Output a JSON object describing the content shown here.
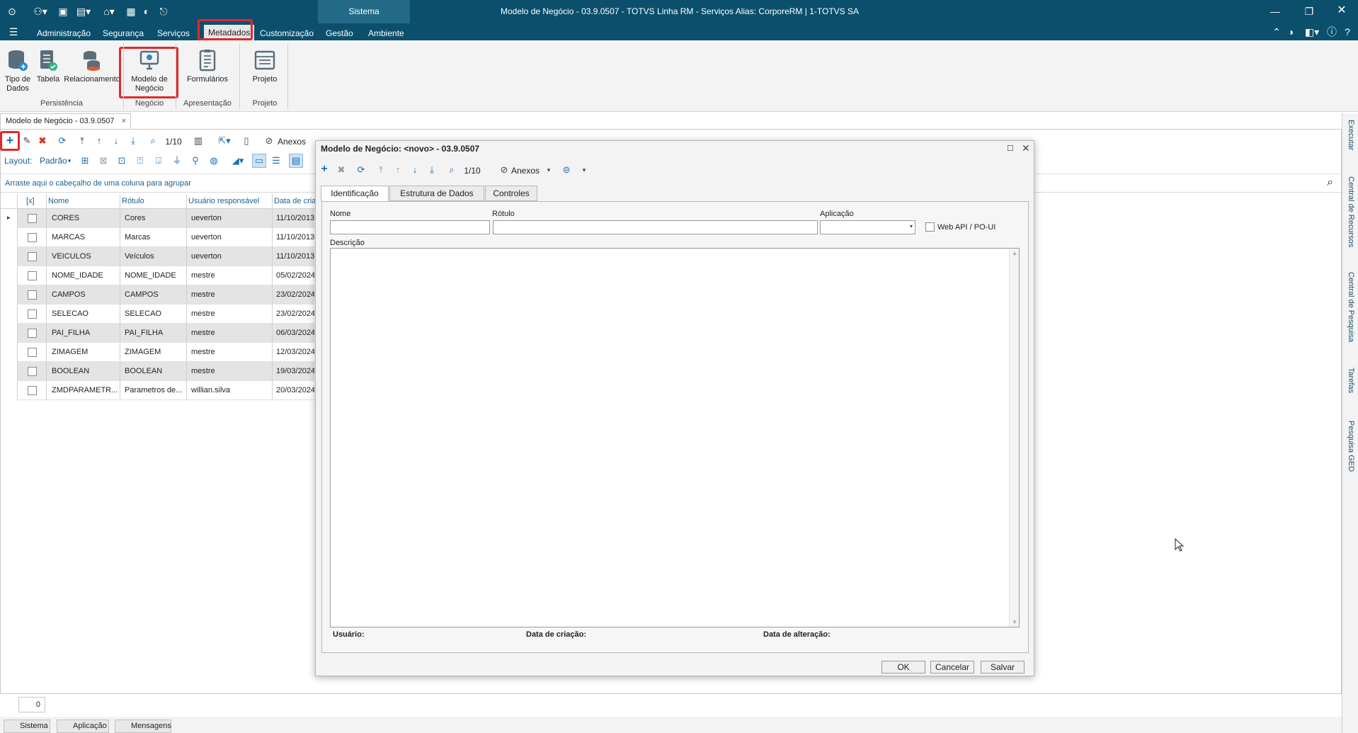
{
  "window": {
    "title": "Modelo de Negócio - 03.9.0507 - TOTVS Linha RM - Serviços  Alias: CorporeRM | 1-TOTVS SA",
    "sistema_label": "Sistema"
  },
  "menu": {
    "items": [
      "Administração",
      "Segurança",
      "Serviços",
      "Metadados",
      "Customização",
      "Gestão",
      "Ambiente"
    ],
    "active": "Metadados"
  },
  "ribbon": {
    "buttons": [
      {
        "label_line1": "Tipo de",
        "label_line2": "Dados",
        "icon": "database-icon"
      },
      {
        "label_line1": "Tabela",
        "label_line2": "",
        "icon": "table-icon"
      },
      {
        "label_line1": "Relacionamento",
        "label_line2": "",
        "icon": "relationship-icon"
      },
      {
        "label_line1": "Modelo de",
        "label_line2": "Negócio",
        "icon": "monitor-icon"
      },
      {
        "label_line1": "Formulários",
        "label_line2": "",
        "icon": "form-icon"
      },
      {
        "label_line1": "Projeto",
        "label_line2": "",
        "icon": "project-icon"
      }
    ],
    "groups": [
      "Persistência",
      "Negócio",
      "Apresentação",
      "Projeto"
    ]
  },
  "document_tab": {
    "label": "Modelo de Negócio - 03.9.0507",
    "close": "×"
  },
  "toolbar": {
    "pager": "1/10",
    "anexos": "Anexos",
    "layout_label": "Layout:",
    "layout_value": "Padrão"
  },
  "group_hint": "Arraste aqui o cabeçalho de uma coluna para agrupar",
  "grid": {
    "headers": [
      "[x]",
      "Nome",
      "Rótulo",
      "Usuário responsável",
      "Data de cria"
    ],
    "rows": [
      {
        "nome": "CORES",
        "rotulo": "Cores",
        "usuario": "ueverton",
        "data": "11/10/2013"
      },
      {
        "nome": "MARCAS",
        "rotulo": "Marcas",
        "usuario": "ueverton",
        "data": "11/10/2013"
      },
      {
        "nome": "VEICULOS",
        "rotulo": "Veículos",
        "usuario": "ueverton",
        "data": "11/10/2013"
      },
      {
        "nome": "NOME_IDADE",
        "rotulo": "NOME_IDADE",
        "usuario": "mestre",
        "data": "05/02/2024"
      },
      {
        "nome": "CAMPOS",
        "rotulo": "CAMPOS",
        "usuario": "mestre",
        "data": "23/02/2024"
      },
      {
        "nome": "SELECAO",
        "rotulo": "SELECAO",
        "usuario": "mestre",
        "data": "23/02/2024"
      },
      {
        "nome": "PAI_FILHA",
        "rotulo": "PAI_FILHA",
        "usuario": "mestre",
        "data": "06/03/2024"
      },
      {
        "nome": "ZIMAGEM",
        "rotulo": "ZIMAGEM",
        "usuario": "mestre",
        "data": "12/03/2024"
      },
      {
        "nome": "BOOLEAN",
        "rotulo": "BOOLEAN",
        "usuario": "mestre",
        "data": "19/03/2024"
      },
      {
        "nome": "ZMDPARAMETR...",
        "rotulo": "Parametros de...",
        "usuario": "willian.silva",
        "data": "20/03/2024"
      }
    ],
    "record_count": "0"
  },
  "side_tabs": [
    "Executar",
    "Central de Recursos",
    "Central de Pesquisa",
    "Tarefas",
    "Pesquisa GED"
  ],
  "dialog": {
    "title": "Modelo de Negócio: <novo> - 03.9.0507",
    "pager": "1/10",
    "anexos": "Anexos",
    "tabs": [
      "Identificação",
      "Estrutura de Dados",
      "Controles"
    ],
    "active_tab": "Identificação",
    "fields": {
      "nome_label": "Nome",
      "rotulo_label": "Rótulo",
      "aplicacao_label": "Aplicação",
      "webapi_label": "Web API / PO-UI",
      "descricao_label": "Descrição",
      "nome_value": "",
      "rotulo_value": "",
      "aplicacao_value": ""
    },
    "footer": {
      "usuario": "Usuário:",
      "data_criacao": "Data de criação:",
      "data_alteracao": "Data de alteração:"
    },
    "buttons": {
      "ok": "OK",
      "cancelar": "Cancelar",
      "salvar": "Salvar"
    }
  },
  "statusbar": {
    "tabs": [
      "Sistema",
      "Aplicação",
      "Mensagens"
    ]
  },
  "colors": {
    "titlebar": "#0b4f6c",
    "accent_red": "#e0282e",
    "link_blue": "#1b5f8c"
  }
}
